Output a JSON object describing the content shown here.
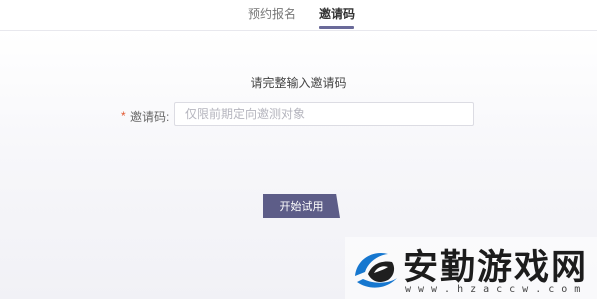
{
  "tabs": {
    "items": [
      {
        "label": "预约报名"
      },
      {
        "label": "邀请码",
        "active": true
      }
    ]
  },
  "form": {
    "instruction": "请完整输入邀请码",
    "required_marker": "*",
    "label": "邀请码:",
    "input_value": "",
    "input_placeholder": "仅限前期定向邀测对象",
    "submit_label": "开始试用"
  },
  "watermark": {
    "title": "安勤游戏网",
    "domain": "www.hzaccw.com"
  },
  "colors": {
    "accent": "#5d5d88",
    "tab_underline": "#6a6a99",
    "required": "#e2572f",
    "logo_blue": "#1677cf"
  }
}
